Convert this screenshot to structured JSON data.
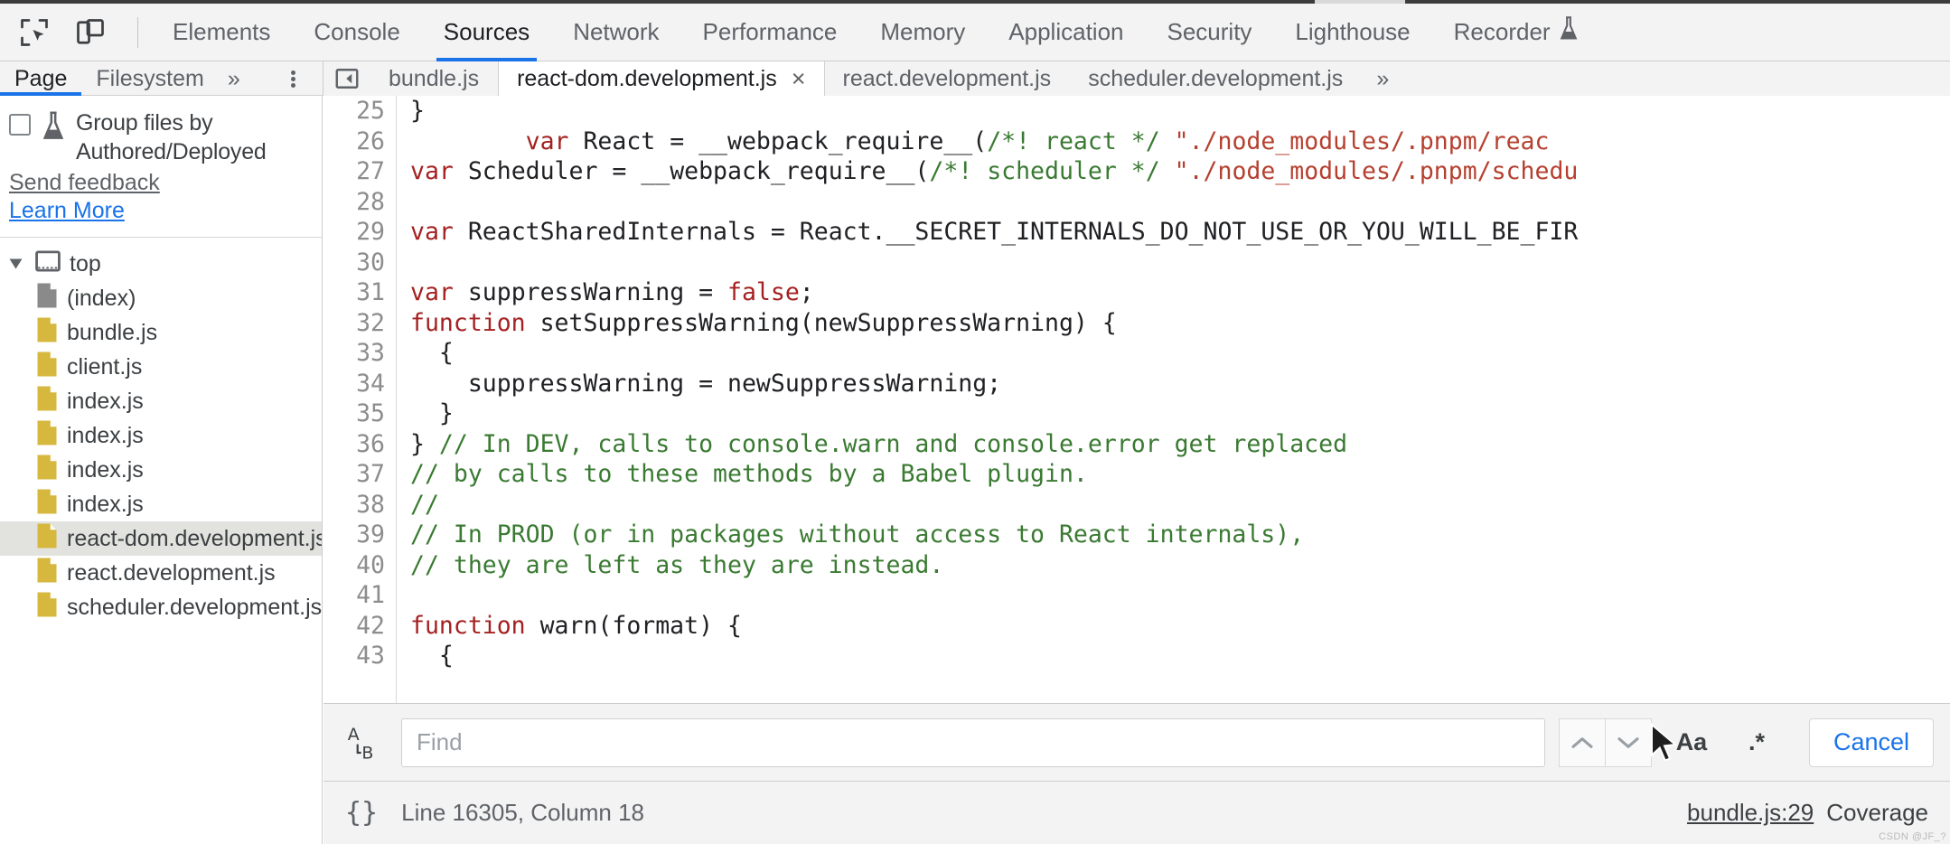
{
  "devtools": {
    "toolbar_icons": [
      {
        "name": "inspect-element-icon",
        "label": "Inspect element"
      },
      {
        "name": "device-toolbar-icon",
        "label": "Toggle device toolbar"
      }
    ],
    "panel_tabs": [
      {
        "label": "Elements",
        "selected": false
      },
      {
        "label": "Console",
        "selected": false
      },
      {
        "label": "Sources",
        "selected": true
      },
      {
        "label": "Network",
        "selected": false
      },
      {
        "label": "Performance",
        "selected": false
      },
      {
        "label": "Memory",
        "selected": false
      },
      {
        "label": "Application",
        "selected": false
      },
      {
        "label": "Security",
        "selected": false
      },
      {
        "label": "Lighthouse",
        "selected": false
      },
      {
        "label": "Recorder",
        "selected": false,
        "experimental": true
      }
    ]
  },
  "navigator": {
    "tabs": [
      {
        "label": "Page",
        "selected": true
      },
      {
        "label": "Filesystem",
        "selected": false
      }
    ],
    "more_label": "»",
    "kebab_label": "More options",
    "group_files": {
      "checked": false,
      "label": "Group files by Authored/Deployed",
      "feedback_label": "Send feedback",
      "learn_more_label": "Learn More"
    },
    "tree": [
      {
        "label": "top",
        "icon": "frame-icon",
        "depth": 0,
        "expanded": true,
        "selected": false
      },
      {
        "label": "(index)",
        "icon": "document-icon",
        "depth": 1,
        "selected": false
      },
      {
        "label": "bundle.js",
        "icon": "js-file-icon",
        "depth": 1,
        "selected": false
      },
      {
        "label": "client.js",
        "icon": "js-file-icon",
        "depth": 1,
        "selected": false
      },
      {
        "label": "index.js",
        "icon": "js-file-icon",
        "depth": 1,
        "selected": false
      },
      {
        "label": "index.js",
        "icon": "js-file-icon",
        "depth": 1,
        "selected": false
      },
      {
        "label": "index.js",
        "icon": "js-file-icon",
        "depth": 1,
        "selected": false
      },
      {
        "label": "index.js",
        "icon": "js-file-icon",
        "depth": 1,
        "selected": false
      },
      {
        "label": "react-dom.development.js",
        "icon": "js-file-icon",
        "depth": 1,
        "selected": true
      },
      {
        "label": "react.development.js",
        "icon": "js-file-icon",
        "depth": 1,
        "selected": false
      },
      {
        "label": "scheduler.development.js",
        "icon": "js-file-icon",
        "depth": 1,
        "selected": false
      }
    ]
  },
  "file_tabs": {
    "panel_toggle_name": "show-navigator-icon",
    "items": [
      {
        "label": "bundle.js",
        "active": false,
        "closable": false
      },
      {
        "label": "react-dom.development.js",
        "active": true,
        "closable": true,
        "close_glyph": "×"
      },
      {
        "label": "react.development.js",
        "active": false,
        "closable": false
      },
      {
        "label": "scheduler.development.js",
        "active": false,
        "closable": false
      }
    ],
    "more_label": "»"
  },
  "editor": {
    "lines": [
      {
        "num": 25,
        "tokens": [
          {
            "t": "}",
            "c": "fn"
          }
        ]
      },
      {
        "num": 26,
        "tokens": [
          {
            "t": "        ",
            "c": "fn"
          },
          {
            "t": "var",
            "c": "kw"
          },
          {
            "t": " React = __webpack_require__(",
            "c": "fn"
          },
          {
            "t": "/*! react */",
            "c": "cmt"
          },
          {
            "t": " ",
            "c": "fn"
          },
          {
            "t": "\"./node_modules/.pnpm/reac",
            "c": "str"
          }
        ]
      },
      {
        "num": 27,
        "tokens": [
          {
            "t": "var",
            "c": "kw"
          },
          {
            "t": " Scheduler = __webpack_require__(",
            "c": "fn"
          },
          {
            "t": "/*! scheduler */",
            "c": "cmt"
          },
          {
            "t": " ",
            "c": "fn"
          },
          {
            "t": "\"./node_modules/.pnpm/schedu",
            "c": "str"
          }
        ]
      },
      {
        "num": 28,
        "tokens": [
          {
            "t": "",
            "c": "fn"
          }
        ]
      },
      {
        "num": 29,
        "tokens": [
          {
            "t": "var",
            "c": "kw"
          },
          {
            "t": " ReactSharedInternals = React.__SECRET_INTERNALS_DO_NOT_USE_OR_YOU_WILL_BE_FIR",
            "c": "fn"
          }
        ]
      },
      {
        "num": 30,
        "tokens": [
          {
            "t": "",
            "c": "fn"
          }
        ]
      },
      {
        "num": 31,
        "tokens": [
          {
            "t": "var",
            "c": "kw"
          },
          {
            "t": " suppressWarning = ",
            "c": "fn"
          },
          {
            "t": "false",
            "c": "kw"
          },
          {
            "t": ";",
            "c": "fn"
          }
        ]
      },
      {
        "num": 32,
        "tokens": [
          {
            "t": "function",
            "c": "kw"
          },
          {
            "t": " setSuppressWarning(newSuppressWarning) {",
            "c": "fn"
          }
        ]
      },
      {
        "num": 33,
        "tokens": [
          {
            "t": "  {",
            "c": "fn"
          }
        ]
      },
      {
        "num": 34,
        "tokens": [
          {
            "t": "    suppressWarning = newSuppressWarning;",
            "c": "fn"
          }
        ]
      },
      {
        "num": 35,
        "tokens": [
          {
            "t": "  }",
            "c": "fn"
          }
        ]
      },
      {
        "num": 36,
        "tokens": [
          {
            "t": "} ",
            "c": "fn"
          },
          {
            "t": "// In DEV, calls to console.warn and console.error get replaced",
            "c": "cmt"
          }
        ]
      },
      {
        "num": 37,
        "tokens": [
          {
            "t": "// by calls to these methods by a Babel plugin.",
            "c": "cmt"
          }
        ]
      },
      {
        "num": 38,
        "tokens": [
          {
            "t": "//",
            "c": "cmt"
          }
        ]
      },
      {
        "num": 39,
        "tokens": [
          {
            "t": "// In PROD (or in packages without access to React internals),",
            "c": "cmt"
          }
        ]
      },
      {
        "num": 40,
        "tokens": [
          {
            "t": "// they are left as they are instead.",
            "c": "cmt"
          }
        ]
      },
      {
        "num": 41,
        "tokens": [
          {
            "t": "",
            "c": "fn"
          }
        ]
      },
      {
        "num": 42,
        "tokens": [
          {
            "t": "function",
            "c": "kw"
          },
          {
            "t": " warn(format) {",
            "c": "fn"
          }
        ]
      },
      {
        "num": 43,
        "tokens": [
          {
            "t": "  {",
            "c": "fn"
          }
        ]
      }
    ]
  },
  "findbar": {
    "replace_toggle_name": "replace-toggle-icon",
    "placeholder": "Find",
    "value": "",
    "prev_label": "Search previous",
    "next_label": "Search next",
    "match_case_label": "Aa",
    "regex_label": ".*",
    "cancel_label": "Cancel"
  },
  "statusbar": {
    "pretty_print_glyph": "{}",
    "position": "Line 16305, Column 18",
    "source_link": "bundle.js:29",
    "coverage_label": "Coverage",
    "watermark": "CSDN @JF_?"
  },
  "colors": {
    "accent": "#1a73e8",
    "toolbar_bg": "#f3f3f3",
    "keyword": "#a52121",
    "string": "#b5402f",
    "comment": "#3a7a32",
    "js_icon": "#d6b83f",
    "doc_icon": "#8a8a8a",
    "selected_row": "#e2e2de"
  }
}
